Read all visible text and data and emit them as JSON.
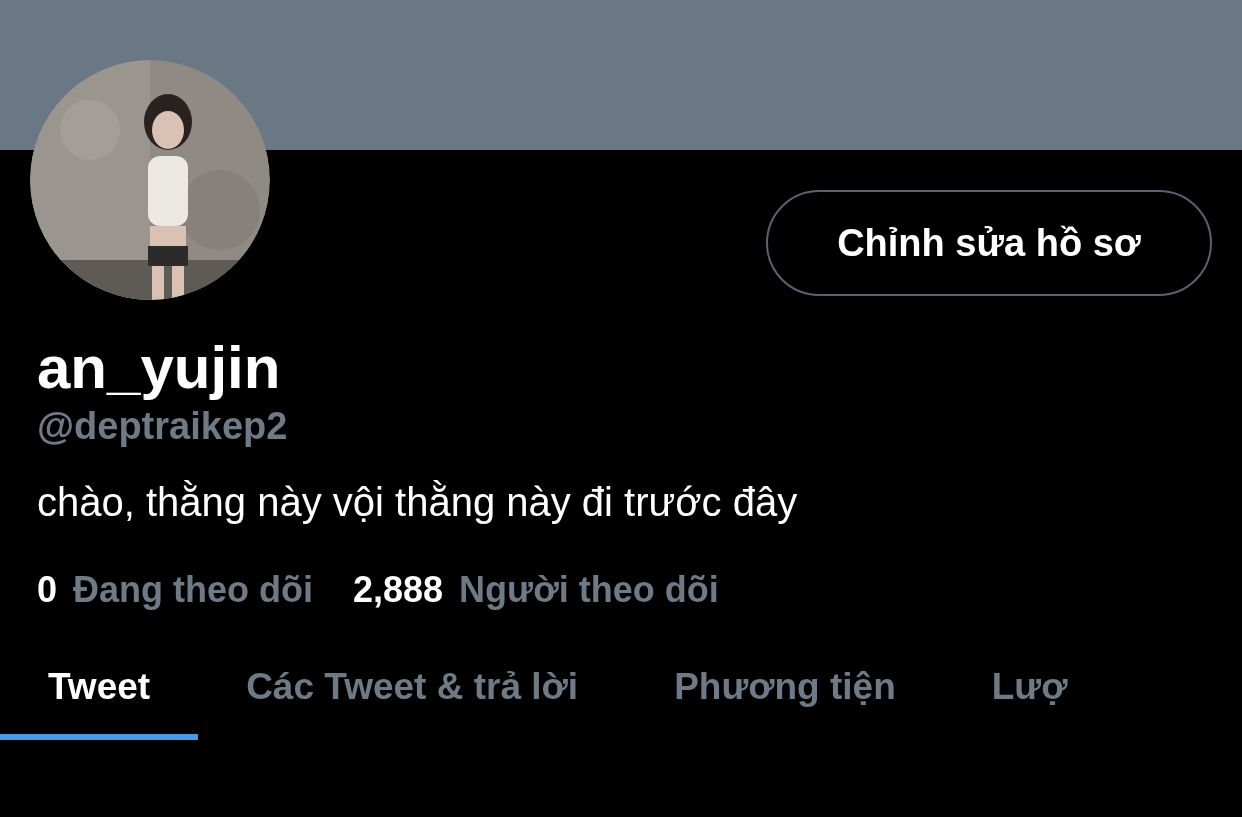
{
  "profile": {
    "edit_button": "Chỉnh sửa hồ sơ",
    "display_name": "an_yujin",
    "handle": "@deptraikep2",
    "bio": "chào, thằng này vội thằng này đi trước đây"
  },
  "stats": [
    {
      "count": "0",
      "label": "Đang theo dõi"
    },
    {
      "count": "2,888",
      "label": "Người theo dõi"
    }
  ],
  "tabs": [
    {
      "label": "Tweet",
      "selected": true
    },
    {
      "label": "Các Tweet & trả lời",
      "selected": false
    },
    {
      "label": "Phương tiện",
      "selected": false
    },
    {
      "label": "Lượ",
      "selected": false
    }
  ]
}
